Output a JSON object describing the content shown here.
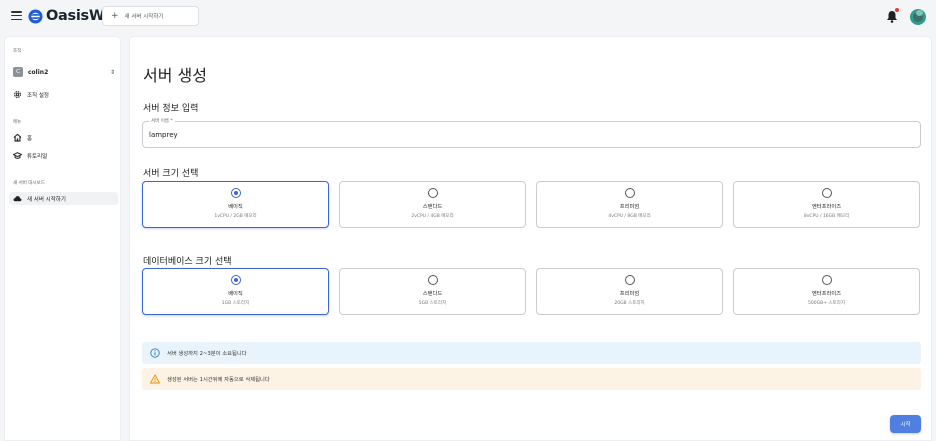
{
  "app": {
    "brand": "OasisW"
  },
  "header": {
    "new_server_button": "새 서버 시작하기"
  },
  "sidebar": {
    "org_section": "조직",
    "org_badge": "C",
    "org_name": "colin2",
    "org_settings": "조직 설정",
    "menu_section": "메뉴",
    "home": "홈",
    "tutorial": "튜토리얼",
    "dashboard_section": "새 서버 대시보드",
    "new_server": "새 서버 시작하기"
  },
  "main": {
    "title": "서버 생성",
    "info_section": "서버 정보 입력",
    "server_name_label": "서버 이름 *",
    "server_name_value": "lamprey",
    "size_section": "서버 크기 선택",
    "size_options": [
      {
        "name": "베이직",
        "desc": "1vCPU / 2GB 메모리",
        "selected": true
      },
      {
        "name": "스탠다드",
        "desc": "2vCPU / 4GB 메모리",
        "selected": false
      },
      {
        "name": "프리미엄",
        "desc": "4vCPU / 8GB 메모리",
        "selected": false
      },
      {
        "name": "엔터프라이즈",
        "desc": "8vCPU / 16GB 메모리",
        "selected": false
      }
    ],
    "db_section": "데이터베이스 크기 선택",
    "db_options": [
      {
        "name": "베이직",
        "desc": "1GB 스토리지",
        "selected": true
      },
      {
        "name": "스탠다드",
        "desc": "5GB 스토리지",
        "selected": false
      },
      {
        "name": "프리미엄",
        "desc": "20GB 스토리지",
        "selected": false
      },
      {
        "name": "엔터프라이즈",
        "desc": "500GB+ 스토리지",
        "selected": false
      }
    ],
    "info_alert": "서버 생성까지 2~3분이 소요됩니다",
    "warn_alert": "생성된 서버는 1시간뒤에 자동으로 삭제됩니다",
    "start_button": "시작"
  },
  "colors": {
    "accent": "#3b66d4",
    "button": "#4f7fe0",
    "info_bg": "#e8f3fc",
    "warn_bg": "#fdf3e5",
    "warn_icon": "#ed8b00",
    "info_icon": "#2f80c8"
  }
}
